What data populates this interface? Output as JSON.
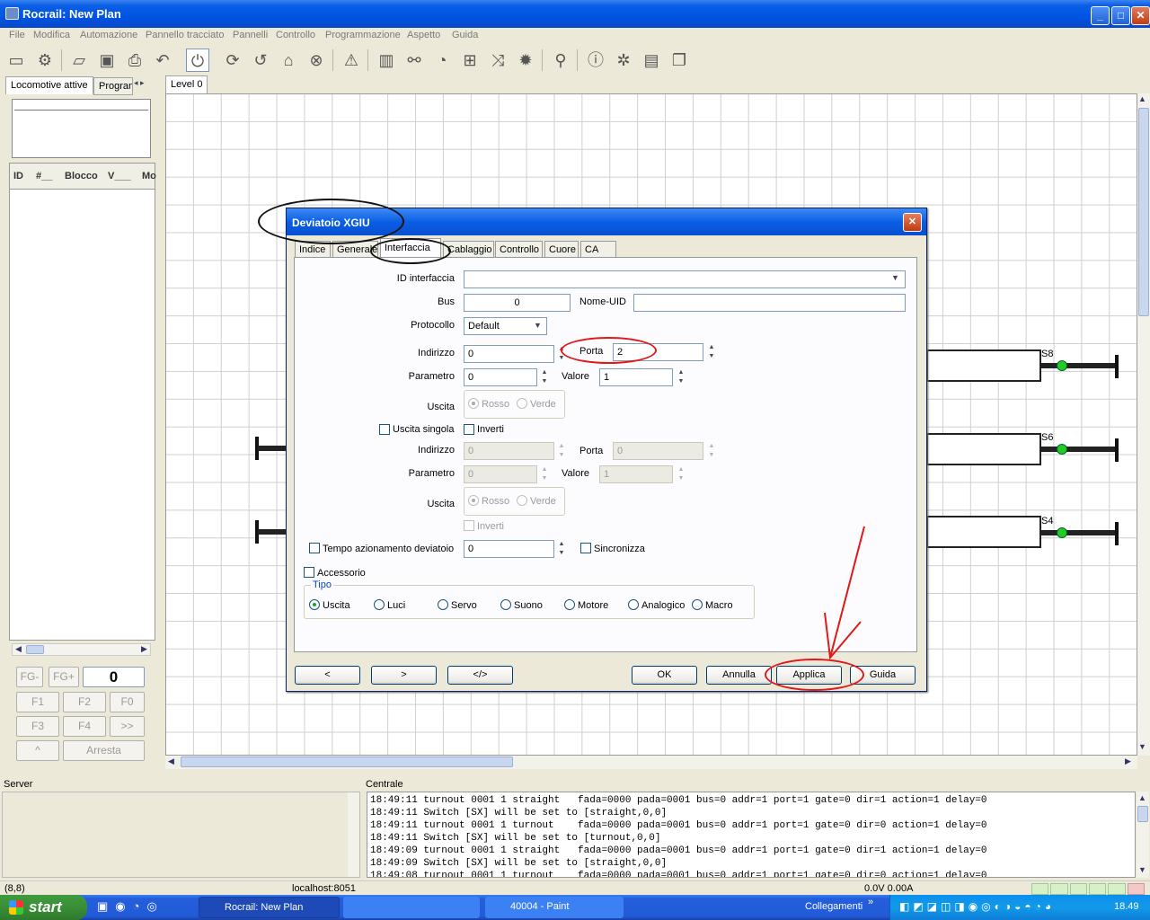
{
  "window": {
    "title": "Rocrail: New Plan"
  },
  "menu": [
    "File",
    "Modifica",
    "Automazione",
    "Pannello tracciato",
    "Pannelli",
    "Controllo",
    "Programmazione",
    "Aspetto",
    "Guida"
  ],
  "left_panel": {
    "tabs": [
      "Locomotive attive",
      "Program"
    ],
    "columns": [
      "ID",
      "#__",
      "Blocco",
      "V___",
      "Mo"
    ],
    "fkeys": [
      "FG-",
      "FG+",
      "0",
      "F1",
      "F2",
      "F0",
      "F3",
      "F4",
      ">>",
      "^",
      "Arresta"
    ]
  },
  "plan": {
    "tab": "Level 0",
    "signals": [
      "S8",
      "S6",
      "S4"
    ]
  },
  "dialog": {
    "title": "Deviatoio XGIU",
    "tabs": [
      "Indice",
      "Generale",
      "Interfaccia",
      "Cablaggio",
      "Controllo",
      "Cuore",
      "CA"
    ],
    "active_tab": "Interfaccia",
    "id_interfaccia_label": "ID interfaccia",
    "id_interfaccia_value": "",
    "bus_label": "Bus",
    "bus_value": "0",
    "nome_uid_label": "Nome-UID",
    "nome_uid_value": "",
    "protocollo_label": "Protocollo",
    "protocollo_value": "Default",
    "indirizzo_label": "Indirizzo",
    "indirizzo_value": "0",
    "porta_label": "Porta",
    "porta_value": "2",
    "parametro_label": "Parametro",
    "parametro_value": "0",
    "valore_label": "Valore",
    "valore_value": "1",
    "uscita_label": "Uscita",
    "rosso_label": "Rosso",
    "verde_label": "Verde",
    "uscita_singola_label": "Uscita singola",
    "inverti_label": "Inverti",
    "indirizzo2_value": "0",
    "porta2_value": "0",
    "parametro2_value": "0",
    "valore2_value": "1",
    "tempo_label": "Tempo azionamento deviatoio",
    "tempo_value": "0",
    "sincronizza_label": "Sincronizza",
    "accessorio_label": "Accessorio",
    "tipo_label": "Tipo",
    "tipo_options": [
      "Uscita",
      "Luci",
      "Servo",
      "Suono",
      "Motore",
      "Analogico",
      "Macro"
    ],
    "tipo_selected": "Uscita",
    "nav_buttons": [
      "<",
      ">",
      "</>"
    ],
    "ok_label": "OK",
    "annulla_label": "Annulla",
    "applica_label": "Applica",
    "guida_label": "Guida"
  },
  "bottom": {
    "server_label": "Server",
    "centrale_label": "Centrale",
    "log": [
      "18:49:11 turnout 0001 1 straight   fada=0000 pada=0001 bus=0 addr=1 port=1 gate=0 dir=1 action=1 delay=0",
      "18:49:11 Switch [SX] will be set to [straight,0,0]",
      "18:49:11 turnout 0001 1 turnout    fada=0000 pada=0001 bus=0 addr=1 port=1 gate=0 dir=0 action=1 delay=0",
      "18:49:11 Switch [SX] will be set to [turnout,0,0]",
      "18:49:09 turnout 0001 1 straight   fada=0000 pada=0001 bus=0 addr=1 port=1 gate=0 dir=1 action=1 delay=0",
      "18:49:09 Switch [SX] will be set to [straight,0,0]",
      "18:49:08 turnout 0001 1 turnout    fada=0000 pada=0001 bus=0 addr=1 port=1 gate=0 dir=0 action=1 delay=0"
    ]
  },
  "status": {
    "coords": "(8,8)",
    "host": "localhost:8051",
    "power": "0.0V 0.00A"
  },
  "taskbar": {
    "start": "start",
    "tasks": [
      "Rocrail: New Plan",
      "",
      "40004 - Paint"
    ],
    "collegamenti": "Collegamenti",
    "clock": "18.49"
  },
  "colors": {
    "titlebar": "#0054e3",
    "annotation_red": "#e01818",
    "signal_green": "#22cc22"
  }
}
